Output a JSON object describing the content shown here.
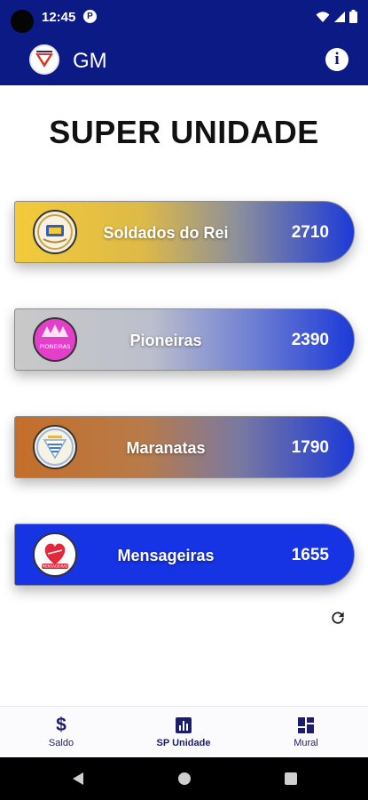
{
  "status_bar": {
    "time": "12:45",
    "app_icon_glyph": "P",
    "icons": [
      "camera-dot",
      "wifi-icon",
      "signal-icon",
      "battery-icon"
    ]
  },
  "app_bar": {
    "title": "GM",
    "logo_icon": "gm-logo-icon",
    "info_icon": "info-icon",
    "info_glyph": "i"
  },
  "page": {
    "heading": "SUPER UNIDADE"
  },
  "units": [
    {
      "name": "Soldados do Rei",
      "score": "2710",
      "logo_icon": "soldados-do-rei-logo-icon",
      "gradient_start": "#f2cb3a",
      "gradient_end": "#1c3ad8"
    },
    {
      "name": "Pioneiras",
      "score": "2390",
      "logo_icon": "pioneiras-logo-icon",
      "logo_text": "PIONEIRAS",
      "gradient_start": "#c9c9c9",
      "gradient_end": "#1c3ad8"
    },
    {
      "name": "Maranatas",
      "score": "1790",
      "logo_icon": "maranatas-logo-icon",
      "gradient_start": "#c46e2a",
      "gradient_end": "#1c3ad8"
    },
    {
      "name": "Mensageiras",
      "score": "1655",
      "logo_icon": "mensageiras-logo-icon",
      "logo_text": "MENSAGEIRAS",
      "gradient_start": "#1633e4",
      "gradient_end": "#1633e4"
    }
  ],
  "refresh": {
    "icon": "refresh-icon"
  },
  "bottom_nav": {
    "items": [
      {
        "label": "Saldo",
        "icon": "dollar-icon",
        "glyph": "$",
        "active": false
      },
      {
        "label": "SP Unidade",
        "icon": "bar-chart-icon",
        "active": true
      },
      {
        "label": "Mural",
        "icon": "dashboard-icon",
        "active": false
      }
    ]
  },
  "system_nav": {
    "buttons": [
      "back-icon",
      "home-icon",
      "recents-icon"
    ]
  },
  "colors": {
    "primary": "#0c1a86",
    "nav_text": "#1d1d6e",
    "card_blue": "#1633e4"
  }
}
